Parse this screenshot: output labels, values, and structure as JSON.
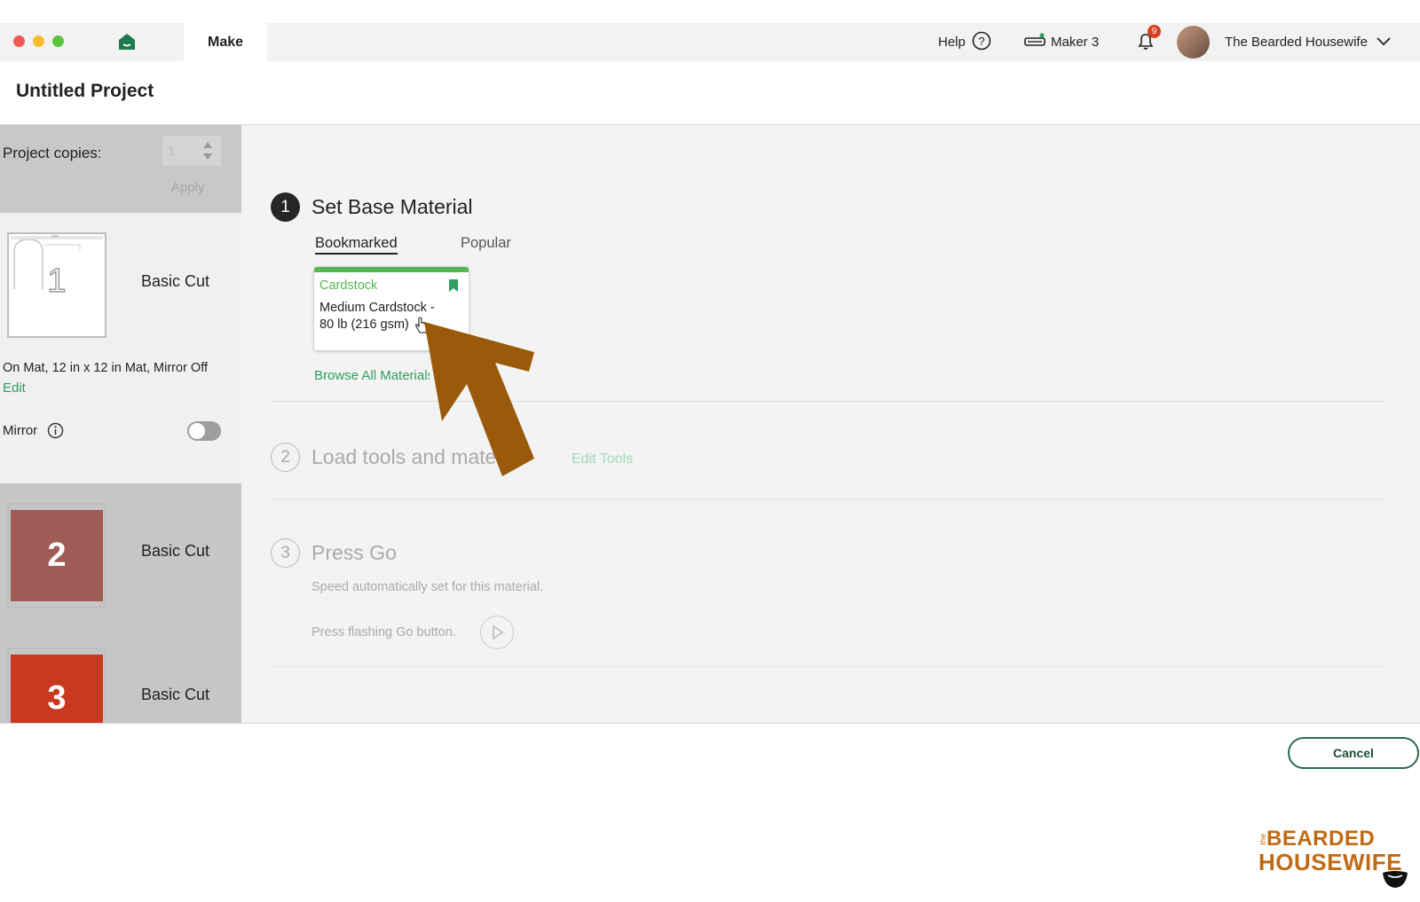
{
  "topbar": {
    "make_tab": "Make",
    "help_label": "Help",
    "machine_label": "Maker 3",
    "notification_count": "9",
    "user_name": "The Bearded Housewife"
  },
  "header": {
    "title": "Untitled Project"
  },
  "sidebar": {
    "project_copies_label": "Project copies:",
    "copies_value": "1",
    "apply_label": "Apply",
    "mat_info": "On Mat, 12 in x 12 in Mat, Mirror Off",
    "edit_link": "Edit",
    "mirror_label": "Mirror",
    "mats": [
      {
        "number": "1",
        "label": "Basic Cut",
        "color": "#ffffff"
      },
      {
        "number": "2",
        "label": "Basic Cut",
        "color": "#9f5b55"
      },
      {
        "number": "3",
        "label": "Basic Cut",
        "color": "#c8391f"
      }
    ]
  },
  "steps": {
    "step1": {
      "number": "1",
      "title": "Set Base Material",
      "tabs": [
        "Bookmarked",
        "Popular"
      ],
      "card": {
        "category": "Cardstock",
        "name_line1": "Medium Cardstock -",
        "name_line2": "80 lb (216 gsm)"
      },
      "browse_link": "Browse All Materials"
    },
    "step2": {
      "number": "2",
      "title": "Load tools and material",
      "edit_tools": "Edit Tools"
    },
    "step3": {
      "number": "3",
      "title": "Press Go",
      "speed_text": "Speed automatically set for this material.",
      "press_text": "Press flashing Go button."
    }
  },
  "footer": {
    "cancel_label": "Cancel"
  },
  "watermark": {
    "line1": "BEARDED",
    "line2": "HOUSEWIFE",
    "prefix": "the"
  },
  "colors": {
    "accent_green": "#2e9e62",
    "card_green": "#52b852",
    "arrow_brown": "#9a5a0a"
  }
}
